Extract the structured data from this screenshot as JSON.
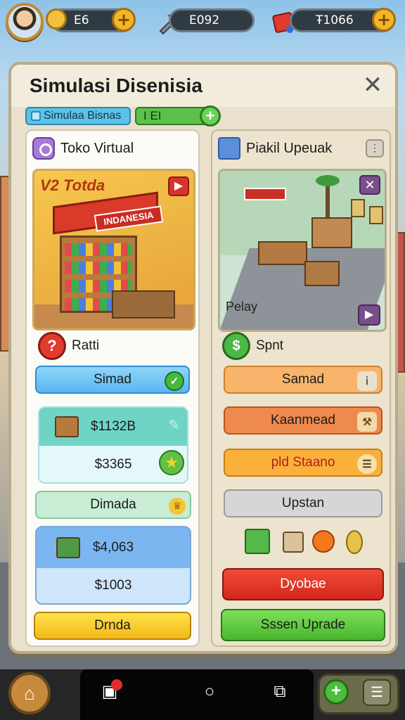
{
  "hud": {
    "currency1": "E6",
    "currency2": "E092",
    "currency3": "Ŧ1066"
  },
  "panel": {
    "title": "Simulasi Disenisia",
    "tab_label": "Simulaa Bisnas",
    "level_label": "I EI"
  },
  "left": {
    "title": "Toko Virtual",
    "scene_label": "V2 Totda",
    "shop_sign": "INDANESIA",
    "status_label": "Ratti",
    "btn_primary": "Simad",
    "card1_price": "$1132B",
    "card1_value": "$3365",
    "btn_secondary": "Dimada",
    "card2_price": "$4,063",
    "card2_value": "$1003",
    "btn_bottom": "Drnda"
  },
  "right": {
    "title": "Piakil Upeuak",
    "scene_label": "Pelay",
    "status_label": "Spnt",
    "btn1": "Samad",
    "btn2": "Kaanmead",
    "btn3": "pld Staano",
    "btn4": "Upstan",
    "btn_red": "Dyobae",
    "btn_green": "Sssen Uprade"
  },
  "colors": {
    "accent_gold": "#f4b52a",
    "accent_green": "#4cbd3c",
    "accent_red": "#e23a2f",
    "accent_blue": "#5ec1e8"
  },
  "icons": [
    "avatar",
    "coin-icon",
    "tools-icon",
    "gem-icon",
    "close-icon",
    "gift-icon",
    "box-icon",
    "orange-icon",
    "egg-icon",
    "home-icon",
    "cards-icon",
    "search-icon",
    "copy-icon",
    "plus-icon",
    "list-icon"
  ]
}
